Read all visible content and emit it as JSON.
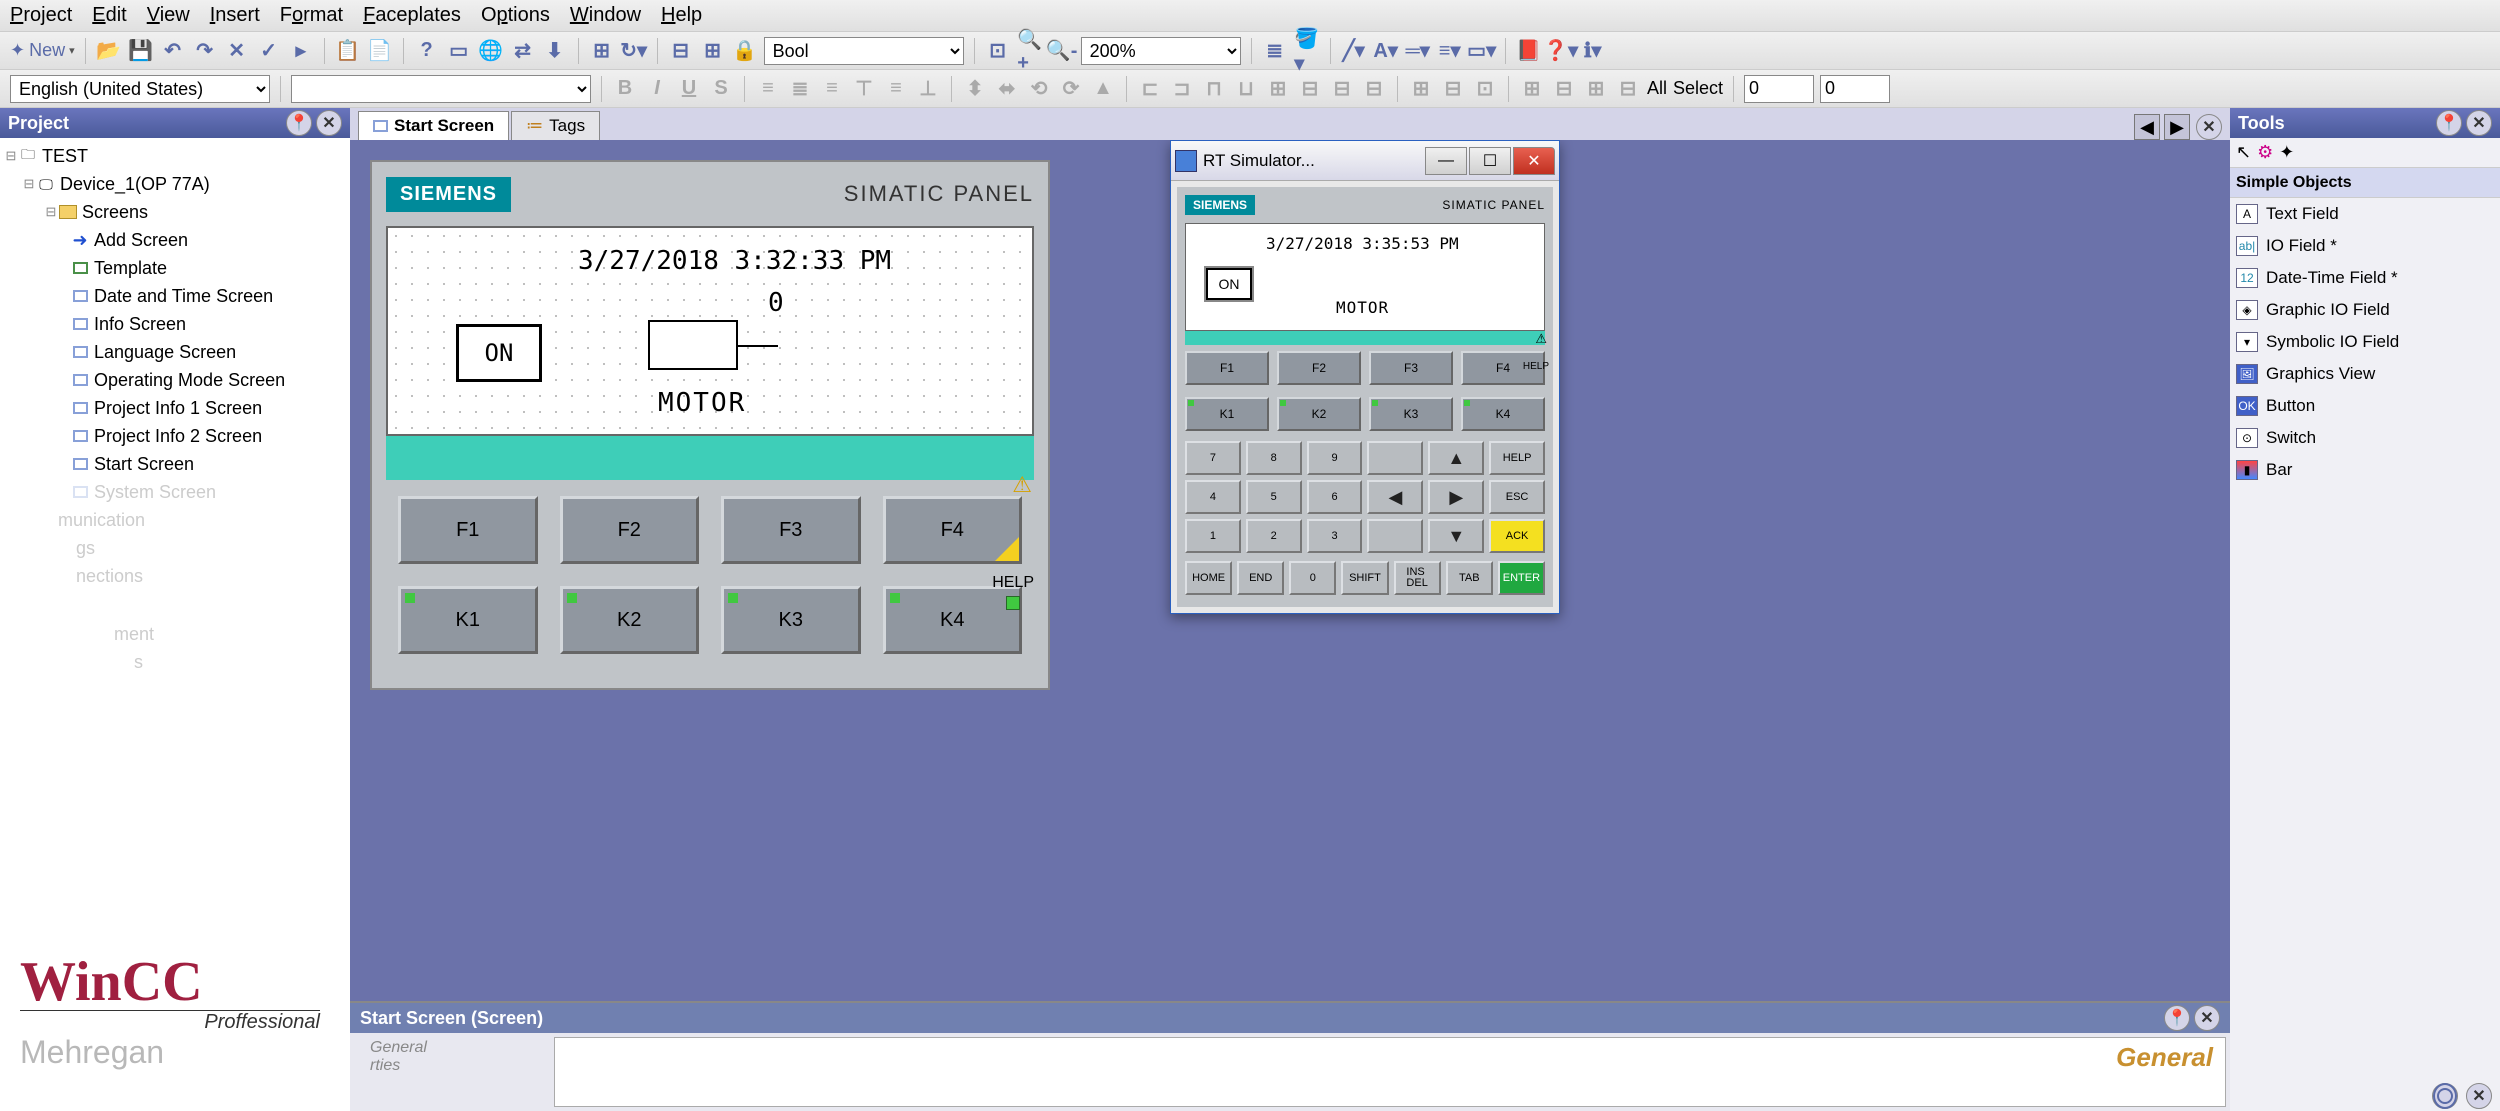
{
  "menubar": [
    "Project",
    "Edit",
    "View",
    "Insert",
    "Format",
    "Faceplates",
    "Options",
    "Window",
    "Help"
  ],
  "toolbar1": {
    "new": "New",
    "type_sel": "Bool",
    "zoom_sel": "200%"
  },
  "toolbar2": {
    "lang_sel": "English (United States)",
    "all": "All",
    "select": "Select",
    "n1": "0",
    "n2": "0"
  },
  "project_panel": {
    "title": "Project",
    "root": "TEST",
    "device": "Device_1(OP 77A)",
    "screens_folder": "Screens",
    "screens": [
      "Add Screen",
      "Template",
      "Date and Time Screen",
      "Info Screen",
      "Language Screen",
      "Operating Mode Screen",
      "Project Info 1 Screen",
      "Project Info 2 Screen",
      "Start Screen",
      "System Screen"
    ],
    "faded": [
      "munication",
      "gs",
      "nections",
      "ment",
      "s"
    ]
  },
  "tabs": {
    "t1": "Start Screen",
    "t2": "Tags"
  },
  "simatic": {
    "brand": "SIEMENS",
    "title": "SIMATIC PANEL",
    "datetime": "3/27/2018 3:32:33 PM",
    "io_val": "0",
    "on": "ON",
    "motor": "MOTOR",
    "f": [
      "F1",
      "F2",
      "F3",
      "F4"
    ],
    "k": [
      "K1",
      "K2",
      "K3",
      "K4"
    ],
    "help": "HELP"
  },
  "sim": {
    "title": "RT Simulator...",
    "brand": "SIEMENS",
    "ptitle": "SIMATIC PANEL",
    "datetime": "3/27/2018 3:35:53 PM",
    "on": "ON",
    "motor": "MOTOR",
    "f": [
      "F1",
      "F2",
      "F3",
      "F4"
    ],
    "k": [
      "K1",
      "K2",
      "K3",
      "K4"
    ],
    "help": "HELP",
    "keys": {
      "n7": "7",
      "n8": "8",
      "n9": "9",
      "help": "HELP",
      "n4": "4",
      "n5": "5",
      "n6": "6",
      "esc": "ESC",
      "n1": "1",
      "n2": "2",
      "n3": "3",
      "ack": "ACK",
      "home": "HOME",
      "end": "END",
      "n0": "0",
      "shift": "SHIFT",
      "insdel": "INS\nDEL",
      "tab": "TAB",
      "enter": "ENTER"
    }
  },
  "props": {
    "title": "Start Screen (Screen)",
    "side": [
      "General",
      "rties"
    ],
    "hdr": "General"
  },
  "tools": {
    "title": "Tools",
    "cat": "Simple Objects",
    "items": [
      "Text Field",
      "IO Field *",
      "Date-Time Field *",
      "Graphic IO Field",
      "Symbolic IO Field",
      "Graphics View",
      "Button",
      "Switch",
      "Bar"
    ]
  },
  "logo": {
    "wincc": "WinCC",
    "prof": "Proffessional",
    "mehr": "Mehregan"
  }
}
